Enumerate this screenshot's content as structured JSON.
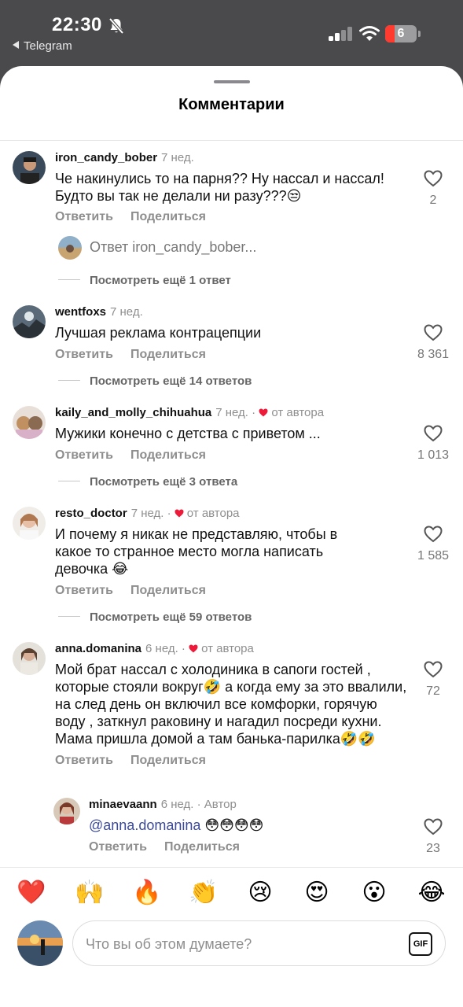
{
  "status_bar": {
    "time": "22:30",
    "back_app": "Telegram",
    "battery": "6"
  },
  "sheet": {
    "title": "Комментарии"
  },
  "actions": {
    "reply": "Ответить",
    "share": "Поделиться"
  },
  "comments": [
    {
      "username": "iron_candy_bober",
      "time": "7 нед.",
      "text": "Че накинулись то на парня?? Ну нассал и нассал! Будто вы так не делали ни разу???😒",
      "likes": "2",
      "reply_preview_prefix": "Ответ",
      "reply_preview_user": "iron_candy_bober...",
      "more": "Посмотреть ещё 1 ответ"
    },
    {
      "username": "wentfoxs",
      "time": "7 нед.",
      "text": "Лучшая реклама контрацепции",
      "likes": "8 361",
      "more": "Посмотреть ещё 14 ответов"
    },
    {
      "username": "kaily_and_molly_chihuahua",
      "time": "7 нед.",
      "author_badge": "от автора",
      "text": "Мужики конечно с детства с приветом ...",
      "likes": "1 013",
      "more": "Посмотреть ещё 3 ответа"
    },
    {
      "username": "resto_doctor",
      "time": "7 нед.",
      "author_badge": "от автора",
      "text": "И почему я никак не представляю, чтобы в какое то странное место могла написать девочка 😂",
      "likes": "1 585",
      "more": "Посмотреть ещё 59 ответов"
    },
    {
      "username": "anna.domanina",
      "time": "6 нед.",
      "author_badge": "от автора",
      "text": "Мой брат нассал с холодиника в сапоги гостей , которые стояли вокруг🤣 а когда ему за это ввалили, на след день он включил все комфорки,  горячую воду , заткнул раковину и нагадил посреди кухни. Мама пришла домой а там банька-парилка🤣🤣",
      "likes": "72"
    }
  ],
  "reply": {
    "username": "minaevaann",
    "time": "6 нед.",
    "badge": "Автор",
    "mention": "@anna.domanina",
    "text": " 😳😳😳😳",
    "likes": "23"
  },
  "emoji_bar": [
    "❤️",
    "🙌",
    "🔥",
    "👏",
    "😢",
    "😍",
    "😮",
    "😂"
  ],
  "composer": {
    "placeholder": "Что вы об этом думаете?",
    "gif_label": "GIF"
  },
  "colors": {
    "heart_red": "#ed1a3a",
    "mention_blue": "#3b4a9a"
  }
}
